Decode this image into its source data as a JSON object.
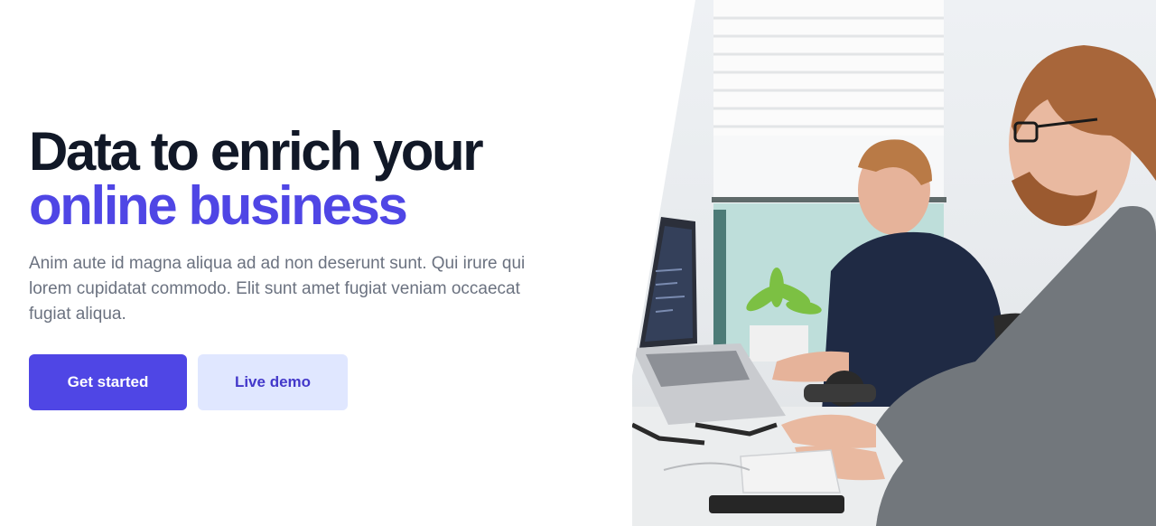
{
  "hero": {
    "headline_line1": "Data to enrich your",
    "headline_line2": "online business",
    "description": "Anim aute id magna aliqua ad ad non deserunt sunt. Qui irure qui lorem cupidatat commodo. Elit sunt amet fugiat veniam occaecat fugiat aliqua.",
    "primary_button": "Get started",
    "secondary_button": "Live demo"
  },
  "colors": {
    "heading": "#111827",
    "accent": "#4f46e5",
    "body_text": "#6b7280",
    "secondary_button_bg": "#e0e7ff",
    "secondary_button_text": "#4338ca"
  },
  "image": {
    "subject": "two-men-working-at-laptops-photo"
  }
}
